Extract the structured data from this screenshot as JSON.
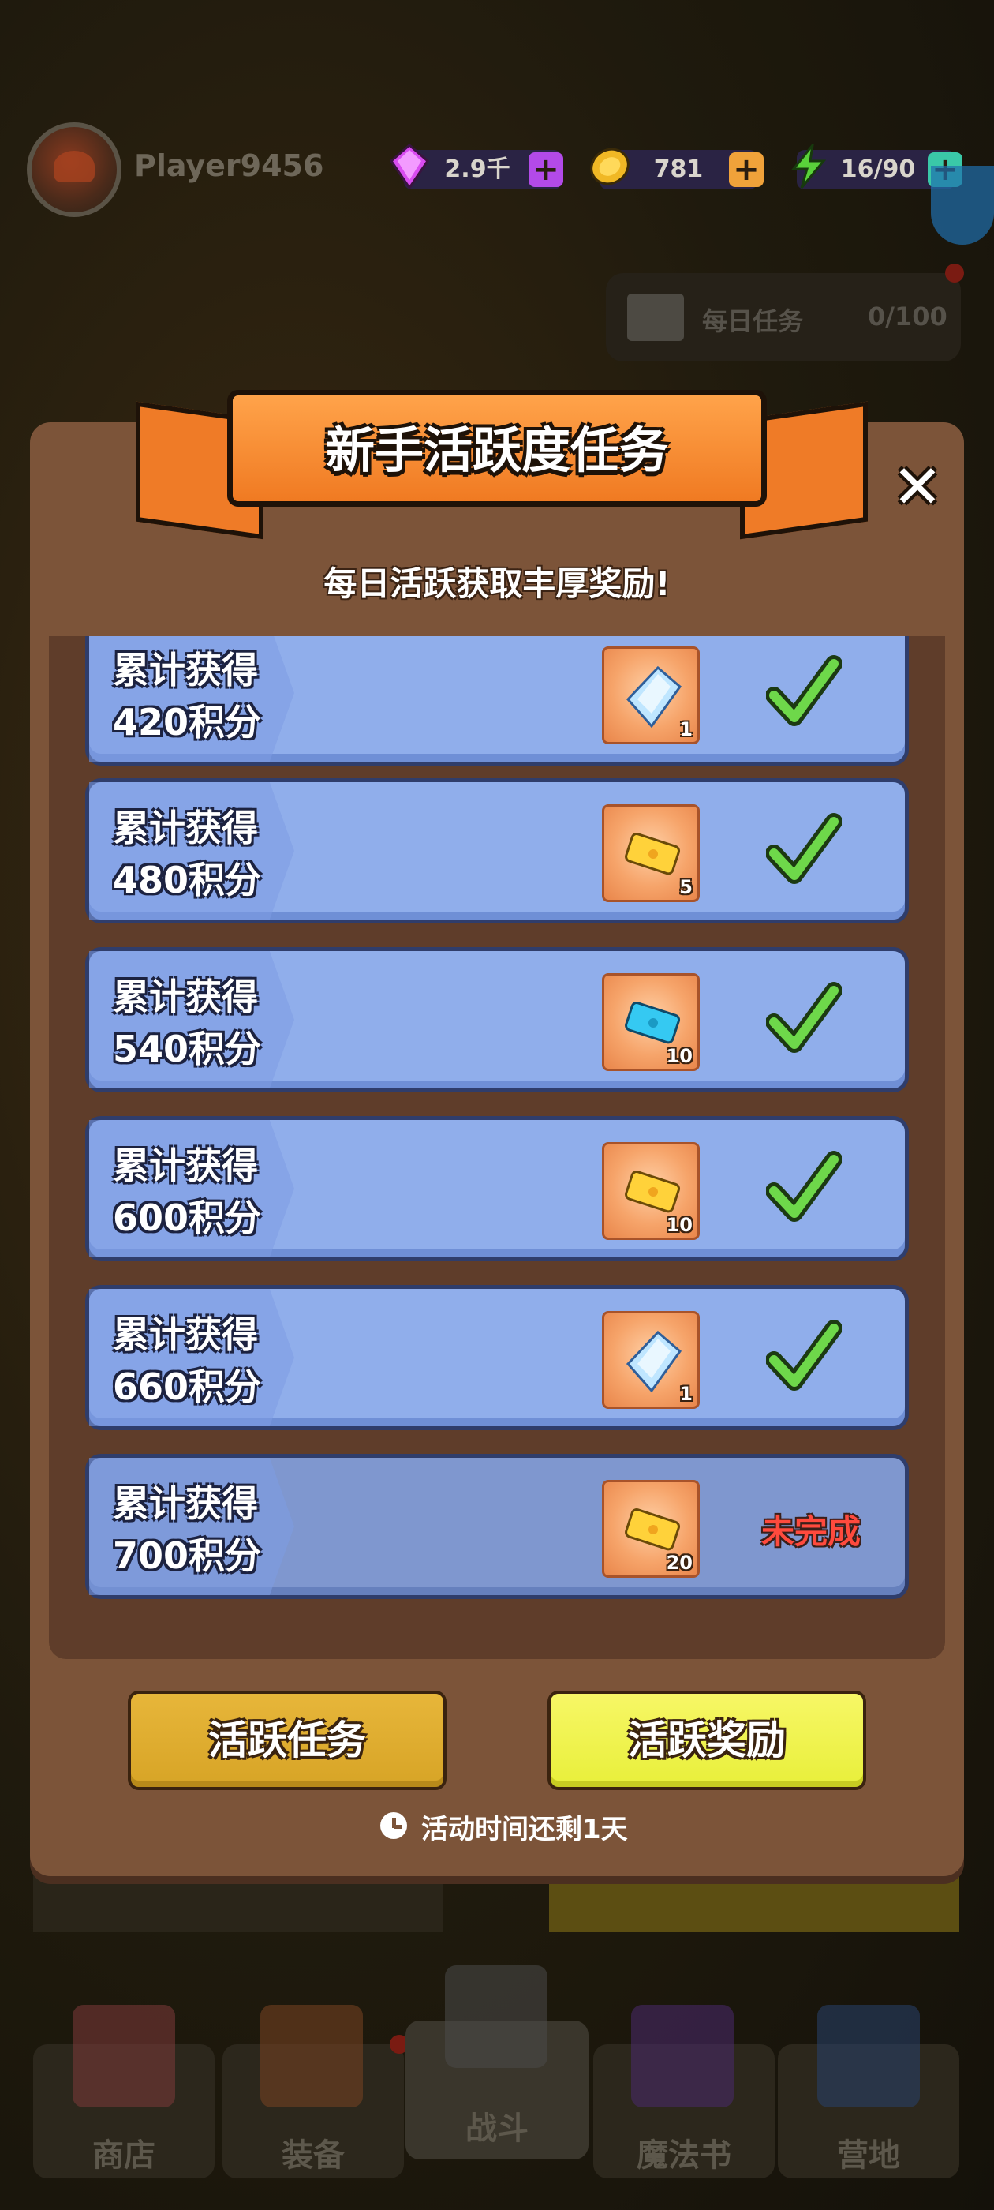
{
  "top_bar": {
    "player_name": "Player9456",
    "gems": "2.9千",
    "coins": "781",
    "energy": "16/90"
  },
  "daily_task": {
    "label": "每日任务",
    "value": "0/100"
  },
  "nav": {
    "items": [
      {
        "label": "商店",
        "icon": "shop-icon"
      },
      {
        "label": "装备",
        "icon": "equipment-icon"
      },
      {
        "label": "战斗",
        "icon": "battle-icon"
      },
      {
        "label": "魔法书",
        "icon": "spellbook-icon"
      },
      {
        "label": "营地",
        "icon": "camp-icon"
      }
    ]
  },
  "modal": {
    "title": "新手活跃度任务",
    "subtitle": "每日活跃获取丰厚奖励!",
    "rows": [
      {
        "line1": "累计获得",
        "line2": "420积分",
        "item": "crystal",
        "count": "1",
        "status": "done"
      },
      {
        "line1": "累计获得",
        "line2": "480积分",
        "item": "gold-ticket",
        "count": "5",
        "status": "done"
      },
      {
        "line1": "累计获得",
        "line2": "540积分",
        "item": "blue-ticket",
        "count": "10",
        "status": "done"
      },
      {
        "line1": "累计获得",
        "line2": "600积分",
        "item": "gold-ticket",
        "count": "10",
        "status": "done"
      },
      {
        "line1": "累计获得",
        "line2": "660积分",
        "item": "crystal",
        "count": "1",
        "status": "done"
      },
      {
        "line1": "累计获得",
        "line2": "700积分",
        "item": "gold-ticket",
        "count": "20",
        "status": "pending",
        "status_label": "未完成"
      }
    ],
    "btn_tasks": "活跃任务",
    "btn_rewards": "活跃奖励",
    "timer": "活动时间还剩1天"
  }
}
